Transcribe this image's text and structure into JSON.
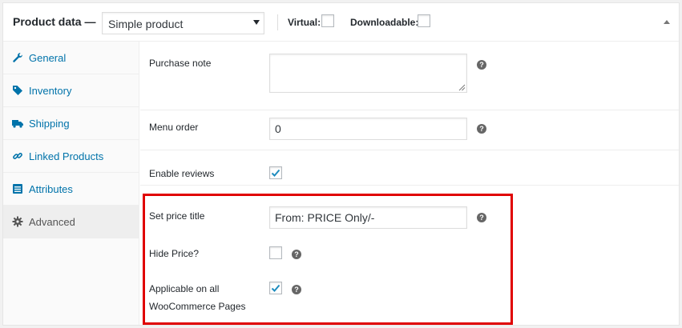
{
  "header": {
    "title": "Product data —",
    "product_type": {
      "selected": "Simple product"
    },
    "virtual_label": "Virtual:",
    "virtual_checked": false,
    "downloadable_label": "Downloadable:",
    "downloadable_checked": false
  },
  "tabs": [
    {
      "label": "General",
      "icon": "wrench-icon",
      "active": false
    },
    {
      "label": "Inventory",
      "icon": "tag-icon",
      "active": false
    },
    {
      "label": "Shipping",
      "icon": "truck-icon",
      "active": false
    },
    {
      "label": "Linked Products",
      "icon": "link-icon",
      "active": false
    },
    {
      "label": "Attributes",
      "icon": "list-icon",
      "active": false
    },
    {
      "label": "Advanced",
      "icon": "gear-icon",
      "active": true
    }
  ],
  "fields": {
    "purchase_note": {
      "label": "Purchase note",
      "value": ""
    },
    "menu_order": {
      "label": "Menu order",
      "value": "0"
    },
    "enable_reviews": {
      "label": "Enable reviews",
      "checked": true
    },
    "set_price_title": {
      "label": "Set price title",
      "value": "From: PRICE Only/-"
    },
    "hide_price": {
      "label": "Hide Price?",
      "checked": false
    },
    "applicable_all": {
      "label": "Applicable on all WooCommerce Pages",
      "checked": true
    }
  },
  "help_glyph": "?",
  "colors": {
    "link": "#0073aa",
    "highlight": "#e00000",
    "checkmark": "#1e8cbe"
  }
}
